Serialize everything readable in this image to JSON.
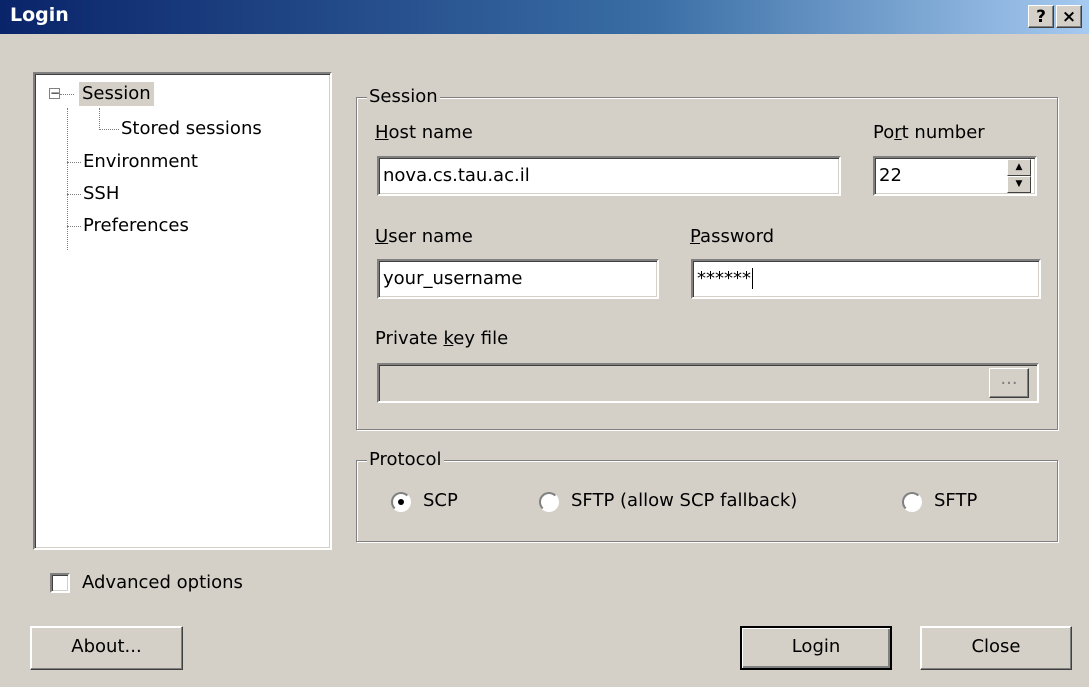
{
  "window": {
    "title": "Login",
    "help_btn": "?",
    "close_btn": "×"
  },
  "tree": {
    "items": [
      {
        "label": "Session",
        "expander": "−"
      },
      {
        "label": "Stored sessions"
      },
      {
        "label": "Environment"
      },
      {
        "label": "SSH"
      },
      {
        "label": "Preferences"
      }
    ]
  },
  "session": {
    "legend": "Session",
    "host_label_key": "H",
    "host_label_rest": "ost name",
    "host_value": "nova.cs.tau.ac.il",
    "port_label_pre": "Po",
    "port_label_key": "r",
    "port_label_rest": "t number",
    "port_value": "22",
    "spin_up": "▲",
    "spin_down": "▼",
    "user_label_key": "U",
    "user_label_rest": "ser name",
    "user_value": "your_username",
    "password_label_key": "P",
    "password_label_rest": "assword",
    "password_value": "******",
    "keyfile_label_pre": "Private ",
    "keyfile_label_key": "k",
    "keyfile_label_rest": "ey file",
    "keyfile_value": "",
    "browse_label": "..."
  },
  "protocol": {
    "legend": "Protocol",
    "options": [
      {
        "label": "SCP",
        "selected": true
      },
      {
        "label": "SFTP (allow SCP fallback)",
        "selected": false
      },
      {
        "label": "SFTP",
        "selected": false
      }
    ]
  },
  "advanced": {
    "label": "Advanced options",
    "checked": false
  },
  "buttons": {
    "about": "About...",
    "login": "Login",
    "close": "Close"
  }
}
